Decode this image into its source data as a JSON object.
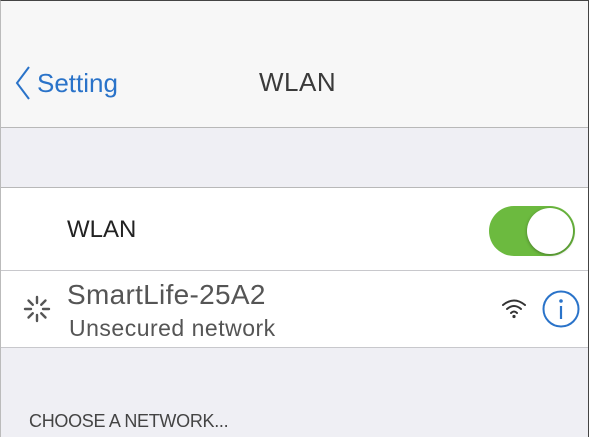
{
  "navbar": {
    "back_label": "Setting",
    "title": "WLAN"
  },
  "wlan_row": {
    "label": "WLAN",
    "toggle_on": true
  },
  "network": {
    "name": "SmartLife-25A2",
    "status": "Unsecured network",
    "icons": [
      "loading-spinner-icon",
      "wifi-signal-icon",
      "info-icon"
    ]
  },
  "section": {
    "header": "CHOOSE A NETWORK..."
  },
  "colors": {
    "accent": "#2a73c9",
    "toggle_on": "#6cba3f",
    "background": "#efeff4"
  }
}
